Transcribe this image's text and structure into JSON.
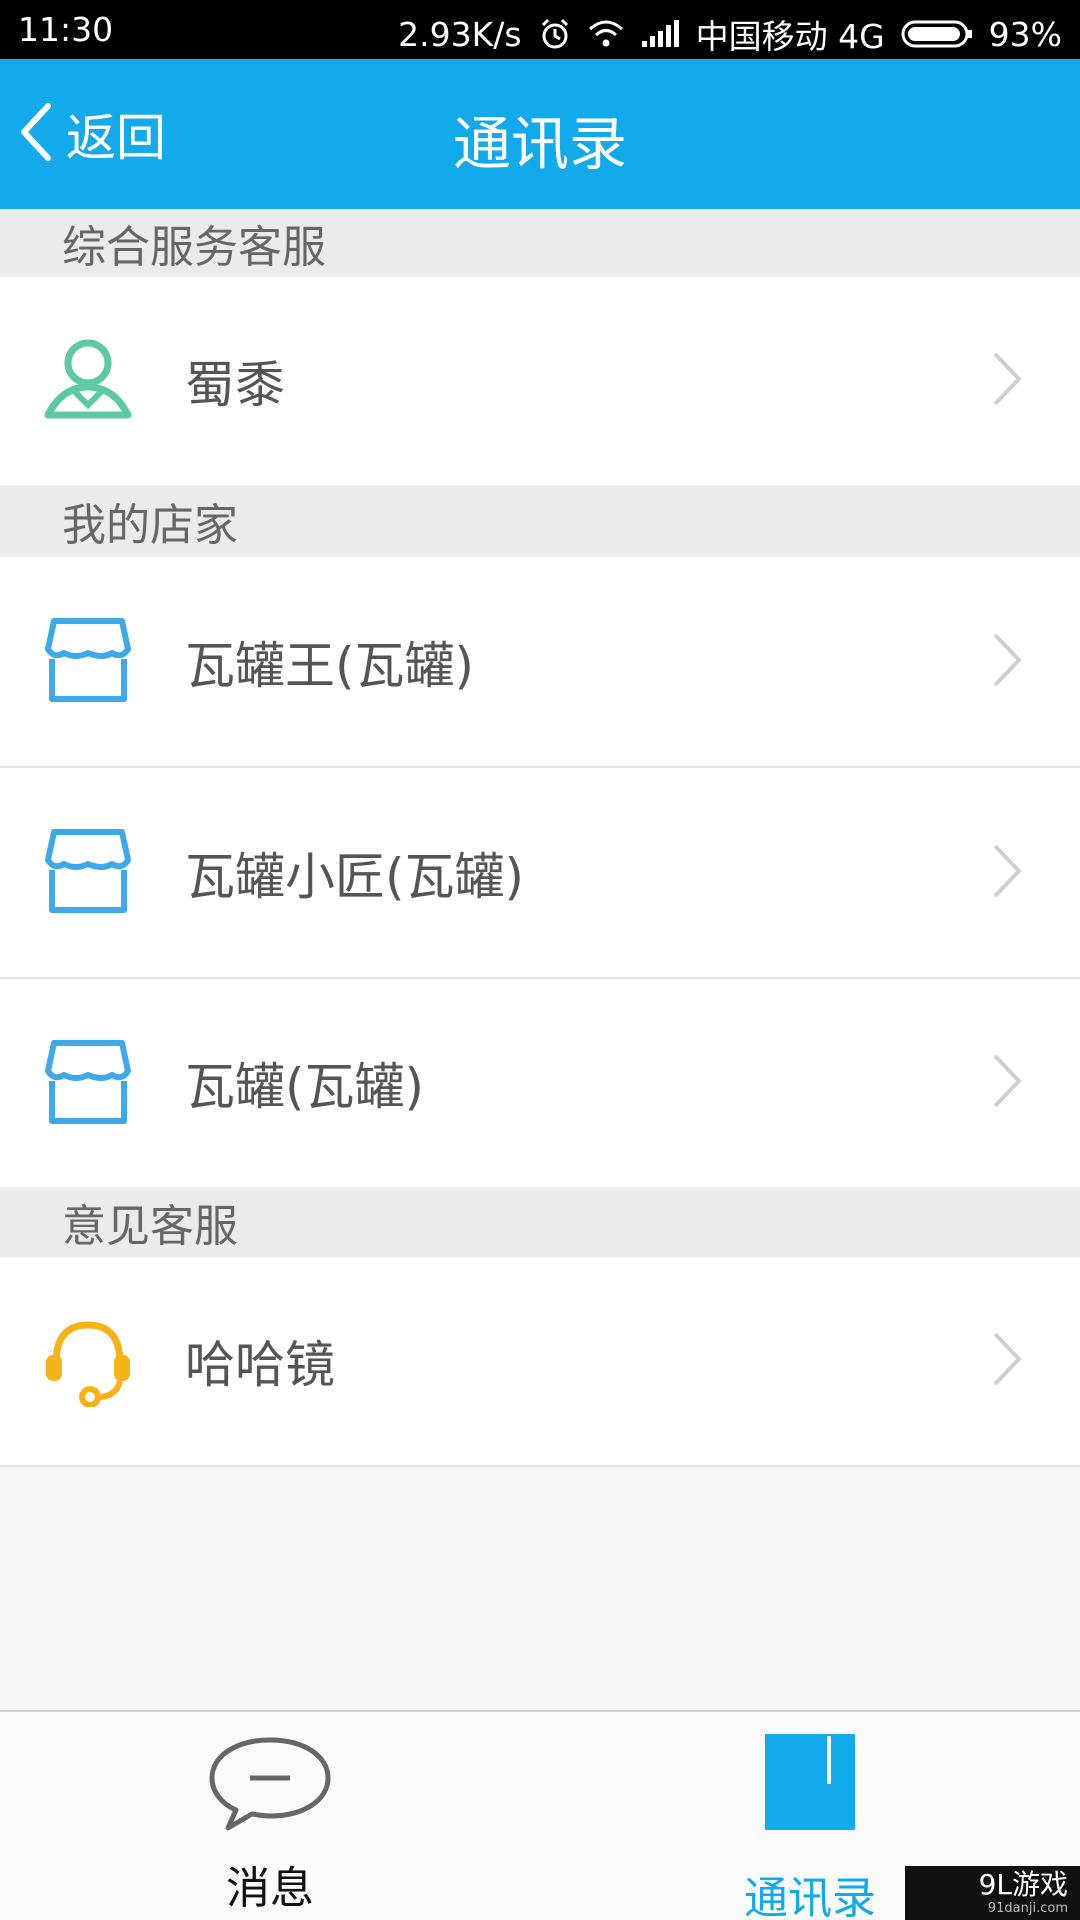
{
  "status_bar": {
    "time": "11:30",
    "speed": "2.93K/s",
    "carrier": "中国移动 4G",
    "battery": "93%",
    "icons": [
      "alarm-icon",
      "wifi-icon",
      "signal-icon",
      "battery-icon"
    ]
  },
  "nav": {
    "back_label": "返回",
    "title": "通讯录"
  },
  "sections": [
    {
      "header": "综合服务客服",
      "items": [
        {
          "name": "蜀黍",
          "icon": "person-icon"
        }
      ]
    },
    {
      "header": "我的店家",
      "items": [
        {
          "name": "瓦罐王(瓦罐)",
          "icon": "store-icon"
        },
        {
          "name": "瓦罐小匠(瓦罐)",
          "icon": "store-icon"
        },
        {
          "name": "瓦罐(瓦罐)",
          "icon": "store-icon"
        }
      ]
    },
    {
      "header": "意见客服",
      "items": [
        {
          "name": "哈哈镜",
          "icon": "headset-icon"
        }
      ]
    }
  ],
  "tabs": [
    {
      "label": "消息",
      "icon": "chat-bubble-icon",
      "active": false
    },
    {
      "label": "通讯录",
      "icon": "contacts-icon",
      "active": true
    }
  ],
  "watermark": {
    "brand": "9L游戏",
    "url": "91danji.com"
  },
  "colors": {
    "accent": "#12aaeb",
    "person_icon": "#5cc9a0",
    "store_icon": "#3da8ea",
    "headset_icon": "#f7b21a"
  }
}
